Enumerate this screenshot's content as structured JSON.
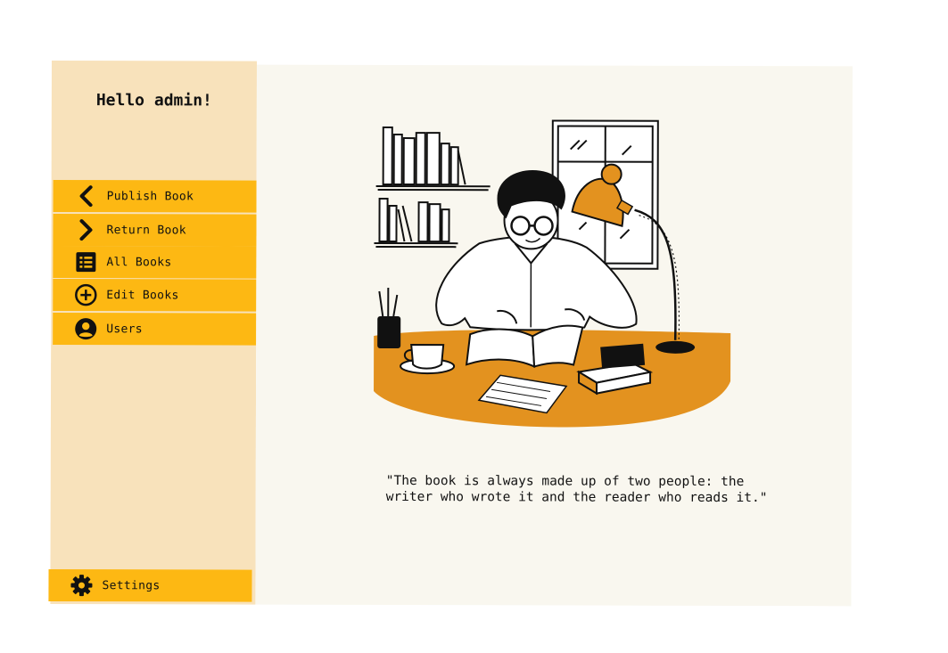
{
  "sidebar": {
    "greeting": "Hello admin!",
    "items": [
      {
        "label": "Publish Book",
        "icon": "chevron-left-icon"
      },
      {
        "label": "Return Book",
        "icon": "chevron-right-icon"
      },
      {
        "label": "All Books",
        "icon": "list-icon"
      },
      {
        "label": "Edit Books",
        "icon": "add-circle-icon"
      },
      {
        "label": "Users",
        "icon": "user-icon"
      }
    ],
    "settings": {
      "label": "Settings",
      "icon": "gear-icon"
    }
  },
  "main": {
    "quote": "\"The book is always made up of two people: the\nwriter who wrote it and the reader who reads it.\""
  },
  "colors": {
    "accent": "#fdb813",
    "sidebar_bg": "#f8e2bb",
    "main_bg": "#f9f7ef",
    "desk": "#e3921f"
  }
}
